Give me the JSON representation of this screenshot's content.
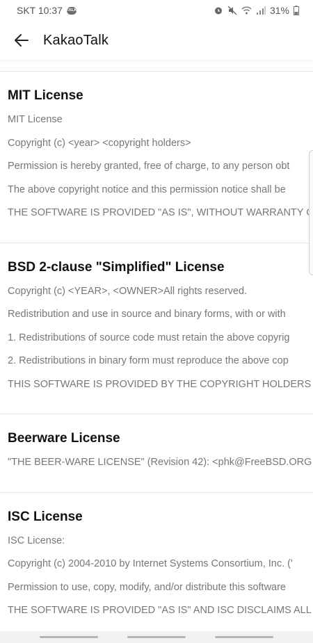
{
  "status_bar": {
    "carrier_time": "SKT 10:37",
    "talk_badge": "TALK",
    "battery": "31%",
    "icons": [
      "alarm-icon",
      "mute-icon",
      "wifi-icon",
      "signal-icon",
      "battery-icon"
    ]
  },
  "app_bar": {
    "title": "KakaoTalk",
    "back_icon": "arrow-left-icon"
  },
  "licenses": [
    {
      "title": "MIT License",
      "lines": [
        "MIT License",
        "Copyright (c) <year> <copyright holders>",
        "Permission is hereby granted, free of charge, to any person obt",
        "The above copyright notice and this permission notice shall be",
        "THE SOFTWARE IS PROVIDED \"AS IS\", WITHOUT WARRANTY OF"
      ]
    },
    {
      "title": "BSD 2-clause \"Simplified\" License",
      "lines": [
        "Copyright (c) <YEAR>, <OWNER>All rights reserved.",
        "Redistribution and use in source and binary forms, with or with",
        "1. Redistributions of source code must retain the above copyrig",
        "2. Redistributions in binary form must reproduce the above cop",
        "THIS SOFTWARE IS PROVIDED BY THE COPYRIGHT HOLDERS AN"
      ]
    },
    {
      "title": "Beerware License",
      "lines": [
        "\"THE BEER-WARE LICENSE\" (Revision 42):  <phk@FreeBSD.ORG"
      ]
    },
    {
      "title": "ISC License",
      "lines": [
        "ISC License:",
        "Copyright (c) 2004-2010 by Internet Systems Consortium, Inc. ('",
        "Permission to use, copy, modify, and/or distribute this software",
        "THE SOFTWARE IS PROVIDED \"AS IS\" AND ISC DISCLAIMS ALL W"
      ]
    }
  ]
}
